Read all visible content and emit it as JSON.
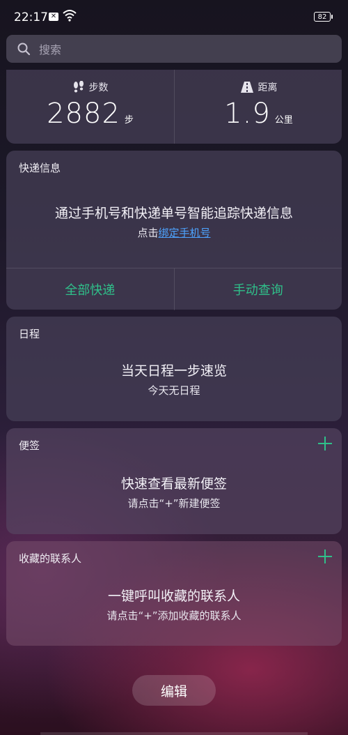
{
  "status_bar": {
    "time": "22:17",
    "battery": "82"
  },
  "search": {
    "placeholder": "搜索"
  },
  "steps": {
    "steps_label": "步数",
    "steps_value": "2882",
    "steps_unit": "步",
    "distance_label": "距离",
    "distance_value": "1.9",
    "distance_unit": "公里"
  },
  "express": {
    "title": "快递信息",
    "main": "通过手机号和快递单号智能追踪快递信息",
    "sub_prefix": "点击",
    "sub_link": "绑定手机号",
    "all_button": "全部快递",
    "manual_button": "手动查询"
  },
  "schedule": {
    "title": "日程",
    "main": "当天日程一步速览",
    "sub": "今天无日程"
  },
  "memo": {
    "title": "便签",
    "main": "快速查看最新便签",
    "sub": "请点击“+”新建便签"
  },
  "contacts": {
    "title": "收藏的联系人",
    "main": "一键呼叫收藏的联系人",
    "sub": "请点击“+”添加收藏的联系人"
  },
  "edit_button": "编辑",
  "colors": {
    "accent_green": "#2fc08a",
    "link_blue": "#4da3ff"
  },
  "icons": [
    "notification-icon",
    "wifi-icon",
    "battery-icon",
    "search-icon",
    "footsteps-icon",
    "road-icon",
    "plus-icon"
  ]
}
